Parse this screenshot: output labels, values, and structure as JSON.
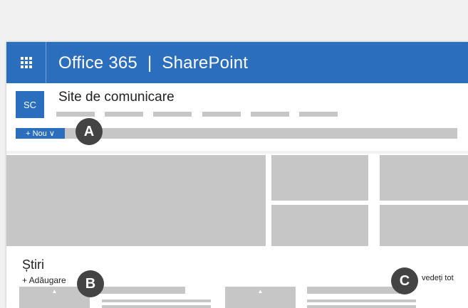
{
  "suite_bar": {
    "product": "Office 365",
    "separator": "|",
    "app": "SharePoint",
    "waffle_icon": "app-launcher-icon",
    "color": "#2a6ebd"
  },
  "site": {
    "logo_text": "SC",
    "title": "Site de comunicare",
    "new_button": "+ Nou",
    "new_chevron": "∨"
  },
  "news": {
    "title": "Știri",
    "add_label": "+ Adăugare",
    "see_all": "vedeți tot"
  },
  "callouts": {
    "a": "A",
    "b": "B",
    "c": "C"
  },
  "colors": {
    "accent": "#2a6ebd",
    "placeholder": "#c6c6c6",
    "callout": "#444444"
  }
}
